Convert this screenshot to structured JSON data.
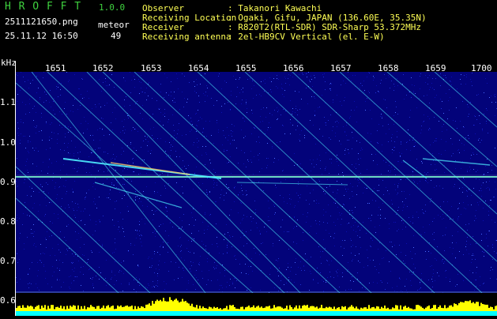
{
  "header": {
    "app_name": "H R O F F T",
    "version": "1.0.0",
    "file_name": "2511121650.png",
    "datetime": "25.11.12 16:50",
    "meteor_label": "meteor",
    "meteor_count": "49",
    "observer_label": "Observer",
    "observer_value": ": Takanori Kawachi",
    "location_label": "Receiving Location",
    "location_value": ": Ogaki, Gifu, JAPAN (136.60E, 35.35N)",
    "receiver_label": "Receiver",
    "receiver_value": ": R820T2(RTL-SDR) SDR-Sharp 53.372MHz",
    "antenna_label": "Receiving antenna",
    "antenna_value": ": 2el-HB9CV Vertical (el. E-W)"
  },
  "axes": {
    "y_unit": "kHz",
    "y_ticks": [
      "1.1",
      "1.0",
      "0.9",
      "0.8",
      "0.7",
      "0.6"
    ],
    "x_ticks": [
      "1651",
      "1652",
      "1653",
      "1654",
      "1655",
      "1656",
      "1657",
      "1658",
      "1659",
      "1700"
    ]
  },
  "colors": {
    "background": "#03037a",
    "trace": "#4ff0ff",
    "carrier": "#7fffd0",
    "strip_yellow": "#ffff00",
    "strip_cyan": "#00ffff"
  }
}
